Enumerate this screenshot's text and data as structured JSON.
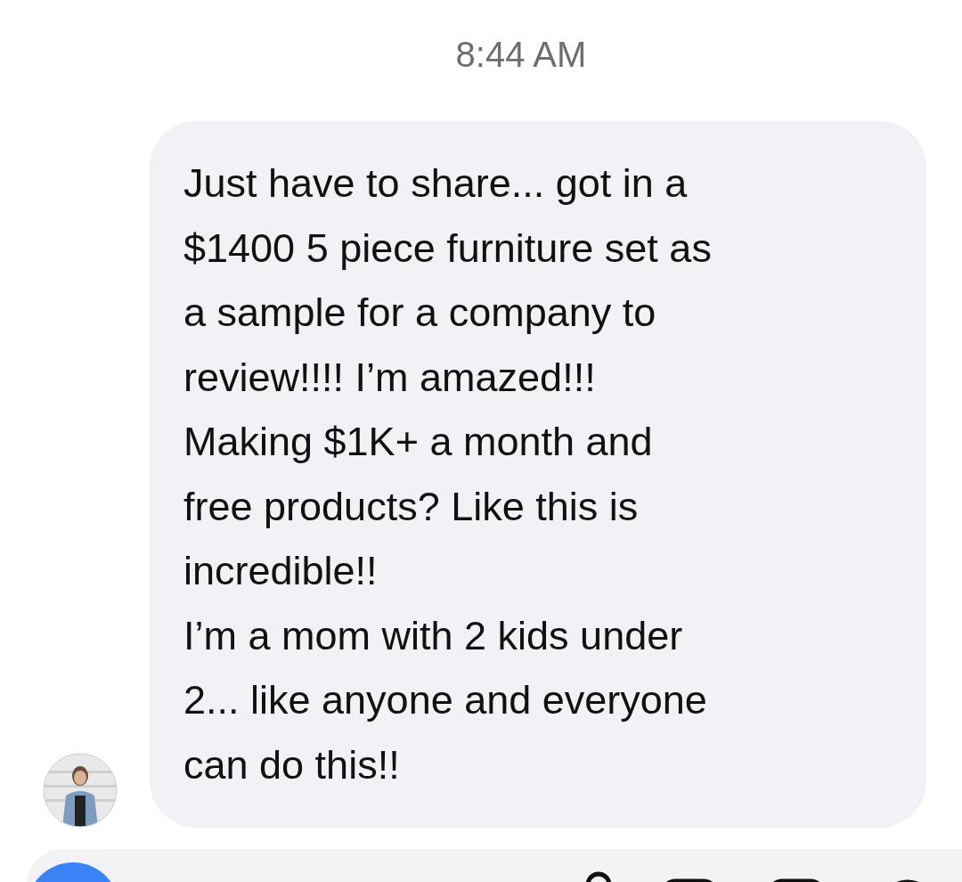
{
  "timestamp": "8:44 AM",
  "message": {
    "text": "Just have to share... got in a\n$1400 5 piece furniture set as\na sample for a company to\nreview!!!! I’m amazed!!!\nMaking $1K+ a month and\nfree products? Like this is\nincredible!!\nI’m a mom with 2 kids under\n2... like anyone and everyone\ncan do this!!"
  }
}
